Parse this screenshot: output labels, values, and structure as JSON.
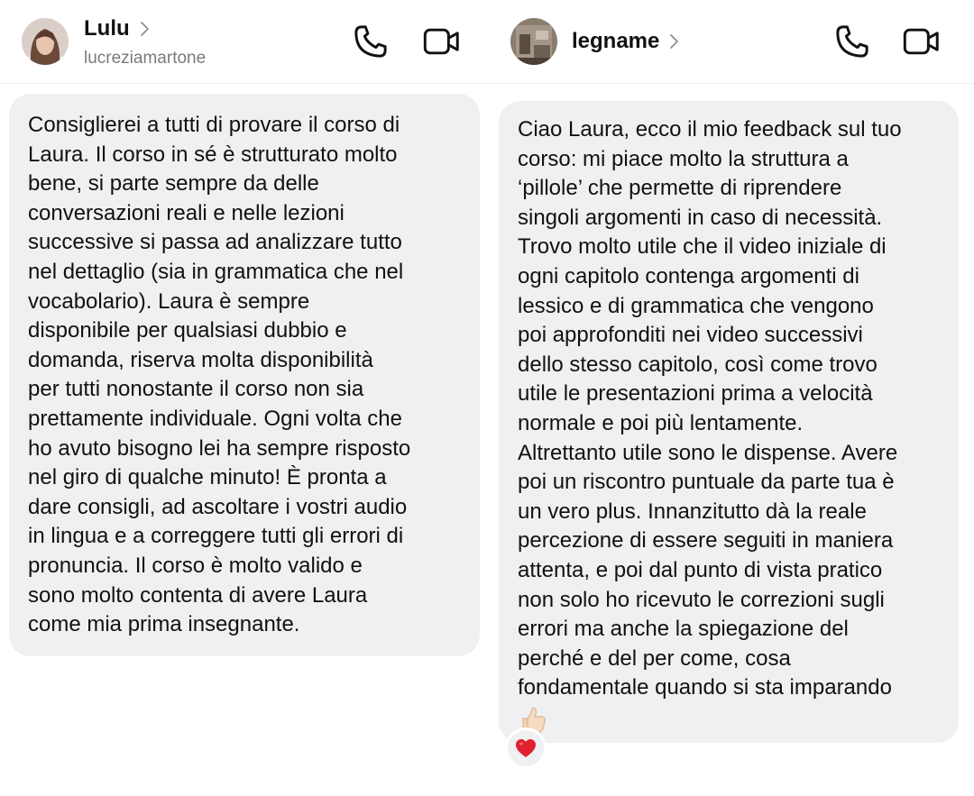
{
  "left_chat": {
    "contact_name": "Lulu",
    "username": "lucreziamartone",
    "icons": {
      "call": "phone-icon",
      "video": "video-camera-icon",
      "chevron": "chevron-right-icon"
    },
    "message_lines": [
      "Consiglierei a tutti di provare il corso di",
      "Laura. Il corso in sé è strutturato molto",
      "bene, si parte sempre da delle",
      "conversazioni reali e nelle lezioni",
      "successive si passa ad analizzare tutto",
      "nel dettaglio (sia in grammatica che nel",
      "vocabolario). Laura è sempre",
      "disponibile per qualsiasi dubbio e",
      "domanda, riserva molta disponibilità",
      "per tutti nonostante il corso non sia",
      "prettamente individuale. Ogni volta che",
      "ho avuto bisogno lei ha sempre risposto",
      "nel giro di qualche minuto! È pronta a",
      "dare consigli, ad ascoltare i vostri audio",
      "in lingua e a correggere tutti gli errori di",
      "pronuncia. Il corso è molto valido e",
      "sono molto contenta di avere Laura",
      "come mia prima insegnante."
    ]
  },
  "right_chat": {
    "contact_name": "legname",
    "icons": {
      "call": "phone-icon",
      "video": "video-camera-icon",
      "chevron": "chevron-right-icon"
    },
    "message_lines": [
      "Ciao Laura, ecco il mio feedback sul tuo",
      "corso: mi piace molto la struttura a",
      "‘pillole’ che permette di riprendere",
      "singoli argomenti in caso di necessità.",
      "Trovo molto utile che il video iniziale di",
      "ogni capitolo contenga argomenti di",
      "lessico e di grammatica che vengono",
      "poi approfonditi nei video successivi",
      "dello stesso capitolo, così come trovo",
      "utile le presentazioni prima a velocità",
      "normale e poi più lentamente.",
      "Altrettanto utile sono le dispense. Avere",
      "poi un riscontro puntuale da parte tua è",
      "un vero plus. Innanzitutto dà la reale",
      "percezione di essere seguiti in maniera",
      "attenta, e poi dal punto di vista pratico",
      "non solo ho ricevuto le correzioni sugli",
      "errori ma anche la spiegazione del",
      "perché e del per come, cosa",
      "fondamentale quando si sta imparando"
    ],
    "message_emoji": "thumbs-up-emoji",
    "reaction": "red-heart-emoji"
  },
  "colors": {
    "bubble_bg": "#f0f0f2",
    "text": "#111111",
    "username": "#7a7a7a",
    "heart": "#e0202f"
  }
}
